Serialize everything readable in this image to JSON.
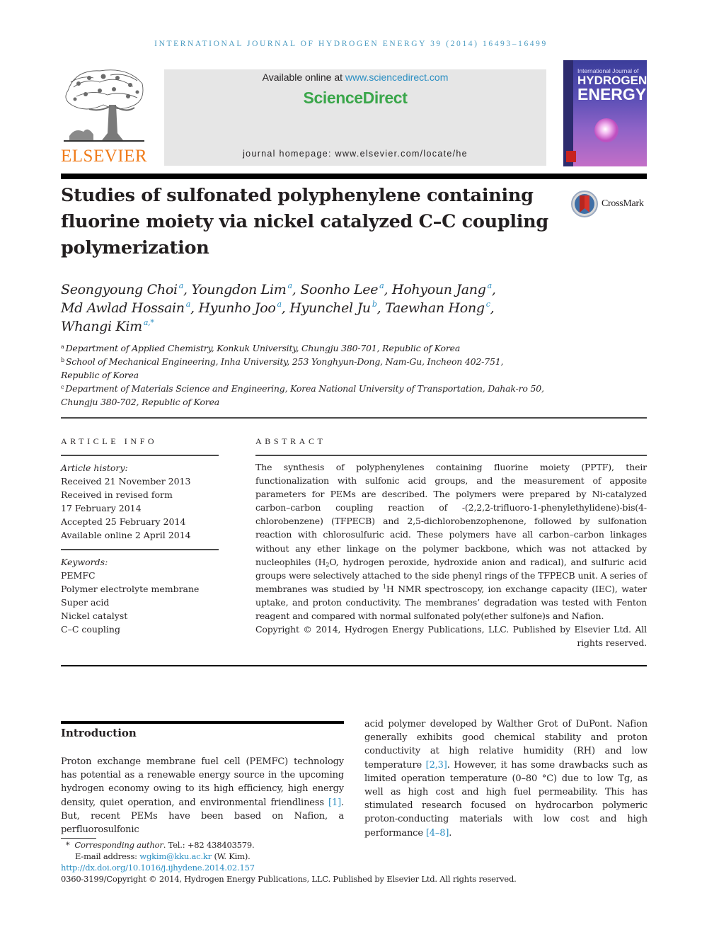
{
  "running_head": "INTERNATIONAL JOURNAL OF HYDROGEN ENERGY 39 (2014) 16493–16499",
  "publisher": {
    "logo_icon": "elsevier-tree-icon",
    "name": "ELSEVIER",
    "brand_color": "#f07c1b"
  },
  "sciencedirect": {
    "available_prefix": "Available online at ",
    "available_link": "www.sciencedirect.com",
    "brand": "ScienceDirect",
    "brand_color": "#3aa64a",
    "homepage": "journal homepage: www.elsevier.com/locate/he"
  },
  "cover": {
    "line1": "International Journal of",
    "line2": "HYDROGEN",
    "line3": "ENERGY"
  },
  "title": "Studies of sulfonated polyphenylene containing fluorine moiety via nickel catalyzed C–C coupling polymerization",
  "crossmark": {
    "icon": "crossmark-icon",
    "label": "CrossMark"
  },
  "authors": [
    {
      "name": "Seongyoung Choi",
      "aff": "a",
      "sep": ", "
    },
    {
      "name": "Youngdon Lim",
      "aff": "a",
      "sep": ", "
    },
    {
      "name": "Soonho Lee",
      "aff": "a",
      "sep": ", "
    },
    {
      "name": "Hohyoun Jang",
      "aff": "a",
      "sep": ","
    },
    {
      "name": "Md Awlad Hossain",
      "aff": "a",
      "sep": ", "
    },
    {
      "name": "Hyunho Joo",
      "aff": "a",
      "sep": ", "
    },
    {
      "name": "Hyunchel Ju",
      "aff": "b",
      "sep": ", "
    },
    {
      "name": "Taewhan Hong",
      "aff": "c",
      "sep": ","
    },
    {
      "name": "Whangi Kim",
      "aff": "a,*",
      "sep": ""
    }
  ],
  "affiliations": [
    {
      "key": "a",
      "lines": [
        "Department of Applied Chemistry, Konkuk University, Chungju 380-701, Republic of Korea"
      ]
    },
    {
      "key": "b",
      "lines": [
        "School of Mechanical Engineering, Inha University, 253 Yonghyun-Dong, Nam-Gu, Incheon 402-751,",
        "Republic of Korea"
      ]
    },
    {
      "key": "c",
      "lines": [
        "Department of Materials Science and Engineering, Korea National University of Transportation, Dahak-ro 50,",
        "Chungju 380-702, Republic of Korea"
      ]
    }
  ],
  "article_info": {
    "heading": "ARTICLE INFO",
    "history_caption": "Article history:",
    "history": [
      "Received 21 November 2013",
      "Received in revised form",
      "17 February 2014",
      "Accepted 25 February 2014",
      "Available online 2 April 2014"
    ],
    "keywords_caption": "Keywords:",
    "keywords": [
      "PEMFC",
      "Polymer electrolyte membrane",
      "Super acid",
      "Nickel catalyst",
      "C–C coupling"
    ]
  },
  "abstract": {
    "heading": "ABSTRACT",
    "p1": "The synthesis of polyphenylenes containing fluorine moiety (PPTF), their functionalization with sulfonic acid groups, and the measurement of apposite parameters for PEMs are described. The polymers were prepared by Ni-catalyzed carbon–carbon coupling reaction of -(2,2,2-trifluoro-1-phenylethylidene)-bis(4-chlorobenzene) (TFPECB) and 2,5-dichlorobenzophenone, followed by sulfonation reaction with chlorosulfuric acid. These polymers have all carbon–carbon linkages without any ether linkage on the polymer backbone, which was not attacked by nucleophiles (H",
    "p1_sub": "2",
    "p1_b": "O, hydrogen peroxide, hydroxide anion and radical), and sulfuric acid groups were selectively attached to the side phenyl rings of the TFPECB unit. A series of membranes was studied by ",
    "p1_sup": "1",
    "p1_c": "H NMR spectroscopy, ion exchange capacity (IEC), water uptake, and proton conductivity. The membranes’ degradation was tested with Fenton reagent and compared with normal sulfonated poly(ether sulfone)s and Nafion.",
    "copyright": "Copyright © 2014, Hydrogen Energy Publications, LLC. Published by Elsevier Ltd. All rights reserved."
  },
  "introduction": {
    "heading": "Introduction",
    "left_a": "Proton exchange membrane fuel cell (PEMFC) technology has potential as a renewable energy source in the upcoming hydrogen economy owing to its high efficiency, high energy density, quiet operation, and environmental friendliness ",
    "left_ref1": "[1]",
    "left_b": ". But, recent PEMs have been based on Nafion, a perfluorosulfonic",
    "right_a": "acid polymer developed by Walther Grot of DuPont. Nafion generally exhibits good chemical stability and proton conductivity at high relative humidity (RH) and low temperature ",
    "right_ref1": "[2,3]",
    "right_b": ". However, it has some drawbacks such as limited operation temperature (0–80 °C) due to low Tg, as well as high cost and high fuel permeability. This has stimulated research focused on hydrocarbon polymeric proton-conducting materials with low cost and high performance ",
    "right_ref2": "[4–8]",
    "right_c": ".",
    "ref_color": "#2a8ec2"
  },
  "footnotes": {
    "star": "*",
    "corr_label": "Corresponding author",
    "corr_rest": ". Tel.: +82 438403579.",
    "email_label": "E-mail address: ",
    "email": "wgkim@kku.ac.kr",
    "email_rest": " (W. Kim).",
    "doi": "http://dx.doi.org/10.1016/j.ijhydene.2014.02.157",
    "issn_copyright": "0360-3199/Copyright © 2014, Hydrogen Energy Publications, LLC. Published by Elsevier Ltd. All rights reserved."
  }
}
